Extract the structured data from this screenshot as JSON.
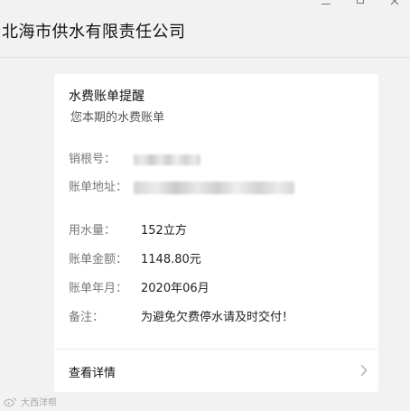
{
  "window": {
    "title": "北海市供水有限责任公司"
  },
  "card": {
    "title": "水费账单提醒",
    "subtitle": "您本期的水费账单",
    "fields": {
      "account": {
        "label": "销根号："
      },
      "address": {
        "label": "账单地址："
      },
      "usage": {
        "label": "用水量：",
        "value": "152立方"
      },
      "amount": {
        "label": "账单金额：",
        "value": "1148.80元"
      },
      "period": {
        "label": "账单年月：",
        "value": "2020年06月"
      },
      "remark": {
        "label": "备注：",
        "value": "为避免欠费停水请及时交付！"
      }
    },
    "footer": {
      "link_label": "查看详情"
    }
  },
  "watermark": {
    "text": "大西洋帮"
  },
  "colors": {
    "background": "#f2f2f2",
    "card": "#ffffff",
    "label": "#777777",
    "value": "#222222"
  },
  "icons": {
    "footer_arrow": "chevron-right-icon",
    "window_close": "close-icon",
    "window_minimize": "minimize-icon",
    "window_maximize": "maximize-icon"
  }
}
